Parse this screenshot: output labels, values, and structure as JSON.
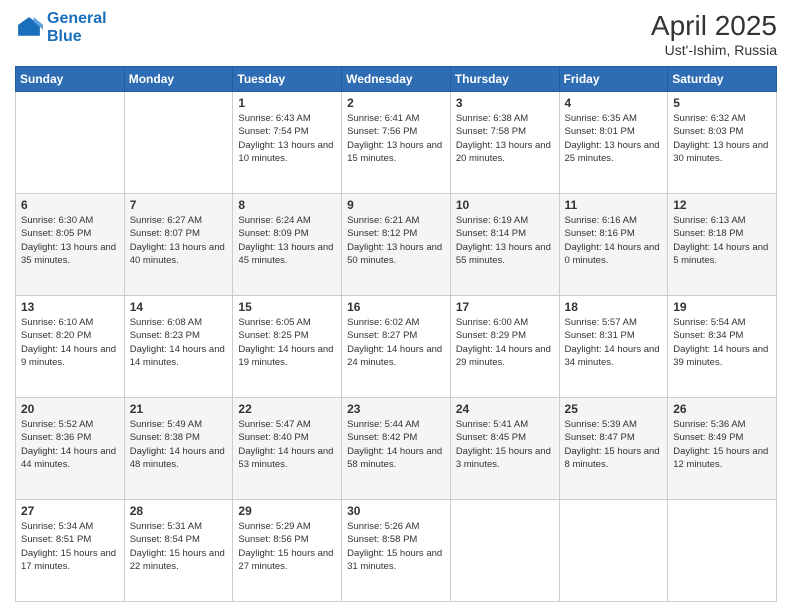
{
  "logo": {
    "line1": "General",
    "line2": "Blue"
  },
  "title": "April 2025",
  "subtitle": "Ust'-Ishim, Russia",
  "days_header": [
    "Sunday",
    "Monday",
    "Tuesday",
    "Wednesday",
    "Thursday",
    "Friday",
    "Saturday"
  ],
  "weeks": [
    [
      {
        "num": "",
        "info": ""
      },
      {
        "num": "",
        "info": ""
      },
      {
        "num": "1",
        "info": "Sunrise: 6:43 AM\nSunset: 7:54 PM\nDaylight: 13 hours and 10 minutes."
      },
      {
        "num": "2",
        "info": "Sunrise: 6:41 AM\nSunset: 7:56 PM\nDaylight: 13 hours and 15 minutes."
      },
      {
        "num": "3",
        "info": "Sunrise: 6:38 AM\nSunset: 7:58 PM\nDaylight: 13 hours and 20 minutes."
      },
      {
        "num": "4",
        "info": "Sunrise: 6:35 AM\nSunset: 8:01 PM\nDaylight: 13 hours and 25 minutes."
      },
      {
        "num": "5",
        "info": "Sunrise: 6:32 AM\nSunset: 8:03 PM\nDaylight: 13 hours and 30 minutes."
      }
    ],
    [
      {
        "num": "6",
        "info": "Sunrise: 6:30 AM\nSunset: 8:05 PM\nDaylight: 13 hours and 35 minutes."
      },
      {
        "num": "7",
        "info": "Sunrise: 6:27 AM\nSunset: 8:07 PM\nDaylight: 13 hours and 40 minutes."
      },
      {
        "num": "8",
        "info": "Sunrise: 6:24 AM\nSunset: 8:09 PM\nDaylight: 13 hours and 45 minutes."
      },
      {
        "num": "9",
        "info": "Sunrise: 6:21 AM\nSunset: 8:12 PM\nDaylight: 13 hours and 50 minutes."
      },
      {
        "num": "10",
        "info": "Sunrise: 6:19 AM\nSunset: 8:14 PM\nDaylight: 13 hours and 55 minutes."
      },
      {
        "num": "11",
        "info": "Sunrise: 6:16 AM\nSunset: 8:16 PM\nDaylight: 14 hours and 0 minutes."
      },
      {
        "num": "12",
        "info": "Sunrise: 6:13 AM\nSunset: 8:18 PM\nDaylight: 14 hours and 5 minutes."
      }
    ],
    [
      {
        "num": "13",
        "info": "Sunrise: 6:10 AM\nSunset: 8:20 PM\nDaylight: 14 hours and 9 minutes."
      },
      {
        "num": "14",
        "info": "Sunrise: 6:08 AM\nSunset: 8:23 PM\nDaylight: 14 hours and 14 minutes."
      },
      {
        "num": "15",
        "info": "Sunrise: 6:05 AM\nSunset: 8:25 PM\nDaylight: 14 hours and 19 minutes."
      },
      {
        "num": "16",
        "info": "Sunrise: 6:02 AM\nSunset: 8:27 PM\nDaylight: 14 hours and 24 minutes."
      },
      {
        "num": "17",
        "info": "Sunrise: 6:00 AM\nSunset: 8:29 PM\nDaylight: 14 hours and 29 minutes."
      },
      {
        "num": "18",
        "info": "Sunrise: 5:57 AM\nSunset: 8:31 PM\nDaylight: 14 hours and 34 minutes."
      },
      {
        "num": "19",
        "info": "Sunrise: 5:54 AM\nSunset: 8:34 PM\nDaylight: 14 hours and 39 minutes."
      }
    ],
    [
      {
        "num": "20",
        "info": "Sunrise: 5:52 AM\nSunset: 8:36 PM\nDaylight: 14 hours and 44 minutes."
      },
      {
        "num": "21",
        "info": "Sunrise: 5:49 AM\nSunset: 8:38 PM\nDaylight: 14 hours and 48 minutes."
      },
      {
        "num": "22",
        "info": "Sunrise: 5:47 AM\nSunset: 8:40 PM\nDaylight: 14 hours and 53 minutes."
      },
      {
        "num": "23",
        "info": "Sunrise: 5:44 AM\nSunset: 8:42 PM\nDaylight: 14 hours and 58 minutes."
      },
      {
        "num": "24",
        "info": "Sunrise: 5:41 AM\nSunset: 8:45 PM\nDaylight: 15 hours and 3 minutes."
      },
      {
        "num": "25",
        "info": "Sunrise: 5:39 AM\nSunset: 8:47 PM\nDaylight: 15 hours and 8 minutes."
      },
      {
        "num": "26",
        "info": "Sunrise: 5:36 AM\nSunset: 8:49 PM\nDaylight: 15 hours and 12 minutes."
      }
    ],
    [
      {
        "num": "27",
        "info": "Sunrise: 5:34 AM\nSunset: 8:51 PM\nDaylight: 15 hours and 17 minutes."
      },
      {
        "num": "28",
        "info": "Sunrise: 5:31 AM\nSunset: 8:54 PM\nDaylight: 15 hours and 22 minutes."
      },
      {
        "num": "29",
        "info": "Sunrise: 5:29 AM\nSunset: 8:56 PM\nDaylight: 15 hours and 27 minutes."
      },
      {
        "num": "30",
        "info": "Sunrise: 5:26 AM\nSunset: 8:58 PM\nDaylight: 15 hours and 31 minutes."
      },
      {
        "num": "",
        "info": ""
      },
      {
        "num": "",
        "info": ""
      },
      {
        "num": "",
        "info": ""
      }
    ]
  ]
}
